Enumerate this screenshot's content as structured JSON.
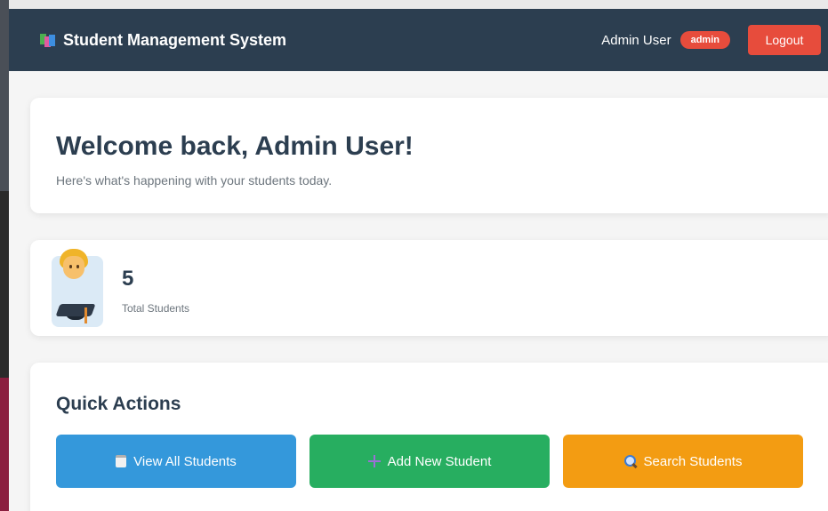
{
  "navbar": {
    "brand": "Student Management System",
    "user_name": "Admin User",
    "role": "admin",
    "logout_label": "Logout"
  },
  "welcome": {
    "title": "Welcome back, Admin User!",
    "subtitle": "Here's what's happening with your students today."
  },
  "stats": {
    "total_students": "5",
    "label": "Total Students",
    "icon": "student-icon"
  },
  "quick_actions": {
    "title": "Quick Actions",
    "buttons": [
      {
        "label": "View All Students",
        "icon": "clipboard-icon",
        "color": "#3498db"
      },
      {
        "label": "Add New Student",
        "icon": "plus-icon",
        "color": "#27ae60"
      },
      {
        "label": "Search Students",
        "icon": "magnifier-icon",
        "color": "#f39c12"
      }
    ]
  },
  "colors": {
    "navbar": "#2c3e50",
    "danger": "#e74c3c",
    "text_dark": "#2c3e50",
    "text_muted": "#6c757d"
  }
}
